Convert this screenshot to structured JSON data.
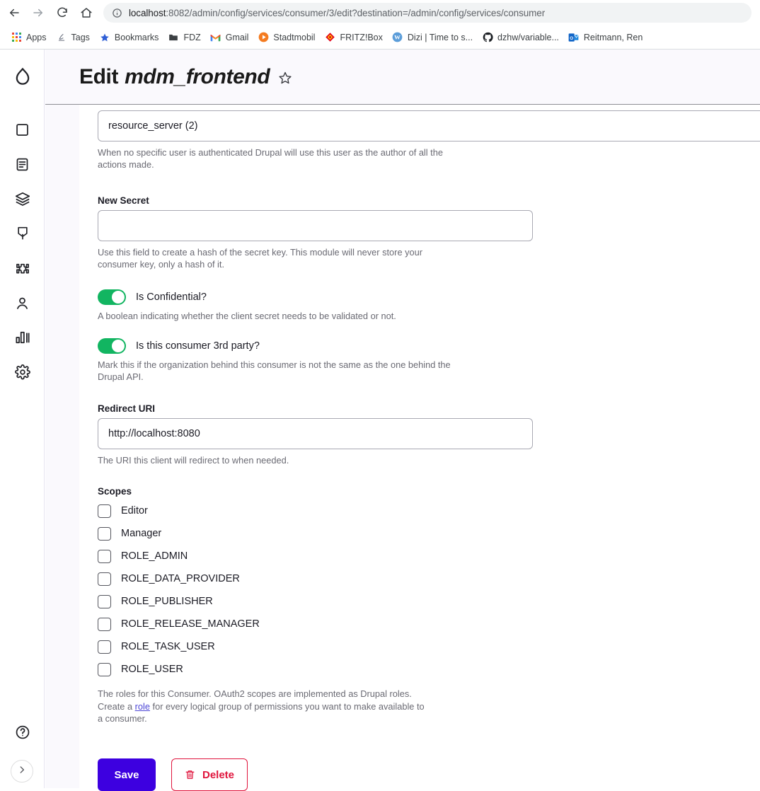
{
  "browser": {
    "nav": {
      "back_label": "Back",
      "forward_label": "Forward",
      "reload_label": "Reload",
      "home_label": "Home"
    },
    "url": {
      "host": "localhost",
      "rest": ":8082/admin/config/services/consumer/3/edit?destination=/admin/config/services/consumer",
      "info_icon": "info-circle-icon"
    },
    "bookmarks": [
      {
        "label": "Apps",
        "icon": "apps-grid-icon"
      },
      {
        "label": "Tags",
        "icon": "tags-icon"
      },
      {
        "label": "Bookmarks",
        "icon": "star-icon"
      },
      {
        "label": "FDZ",
        "icon": "folder-icon"
      },
      {
        "label": "Gmail",
        "icon": "gmail-icon"
      },
      {
        "label": "Stadtmobil",
        "icon": "play-circle-icon"
      },
      {
        "label": "FRITZ!Box",
        "icon": "fritzbox-icon"
      },
      {
        "label": "Dizi | Time to s...",
        "icon": "wordpress-icon"
      },
      {
        "label": "dzhw/variable...",
        "icon": "github-icon"
      },
      {
        "label": "Reitmann, Ren",
        "icon": "outlook-icon"
      }
    ]
  },
  "sidebar": {
    "logo": "drupal-droplet-icon",
    "items": [
      {
        "name": "content",
        "icon": "square-icon"
      },
      {
        "name": "structure",
        "icon": "document-lines-icon"
      },
      {
        "name": "appearance",
        "icon": "layers-icon"
      },
      {
        "name": "extend",
        "icon": "tag-icon"
      },
      {
        "name": "modules",
        "icon": "puzzle-icon"
      },
      {
        "name": "people",
        "icon": "person-icon"
      },
      {
        "name": "reports",
        "icon": "bar-chart-icon"
      },
      {
        "name": "configuration",
        "icon": "gear-icon"
      }
    ],
    "help": {
      "name": "help",
      "icon": "question-circle-icon"
    },
    "expand": {
      "name": "expand-sidebar",
      "icon": "chevron-right-icon"
    }
  },
  "header": {
    "title_prefix": "Edit",
    "title_name": "mdm_frontend",
    "star_icon": "star-outline-icon"
  },
  "form": {
    "user_field": {
      "value": "resource_server (2)",
      "description": "When no specific user is authenticated Drupal will use this user as the author of all the actions made."
    },
    "new_secret": {
      "label": "New Secret",
      "value": "",
      "description": "Use this field to create a hash of the secret key. This module will never store your consumer key, only a hash of it."
    },
    "is_confidential": {
      "label": "Is Confidential?",
      "checked": true,
      "description": "A boolean indicating whether the client secret needs to be validated or not."
    },
    "is_third_party": {
      "label": "Is this consumer 3rd party?",
      "checked": true,
      "description": "Mark this if the organization behind this consumer is not the same as the one behind the Drupal API."
    },
    "redirect_uri": {
      "label": "Redirect URI",
      "value": "http://localhost:8080",
      "description": "The URI this client will redirect to when needed."
    },
    "scopes": {
      "label": "Scopes",
      "options": [
        {
          "label": "Editor",
          "checked": false
        },
        {
          "label": "Manager",
          "checked": false
        },
        {
          "label": "ROLE_ADMIN",
          "checked": false
        },
        {
          "label": "ROLE_DATA_PROVIDER",
          "checked": false
        },
        {
          "label": "ROLE_PUBLISHER",
          "checked": false
        },
        {
          "label": "ROLE_RELEASE_MANAGER",
          "checked": false
        },
        {
          "label": "ROLE_TASK_USER",
          "checked": false
        },
        {
          "label": "ROLE_USER",
          "checked": false
        }
      ],
      "description_part1": "The roles for this Consumer. OAuth2 scopes are implemented as Drupal roles. Create a ",
      "description_link": "role",
      "description_part2": " for every logical group of permissions you want to make available to a consumer."
    },
    "actions": {
      "save_label": "Save",
      "delete_label": "Delete",
      "delete_icon": "trash-icon"
    }
  },
  "colors": {
    "toggle_on": "#12b561",
    "save_button": "#3d00e0",
    "delete_red": "#e0143c",
    "link": "#4b45d6",
    "header_band": "#faf9fd"
  }
}
